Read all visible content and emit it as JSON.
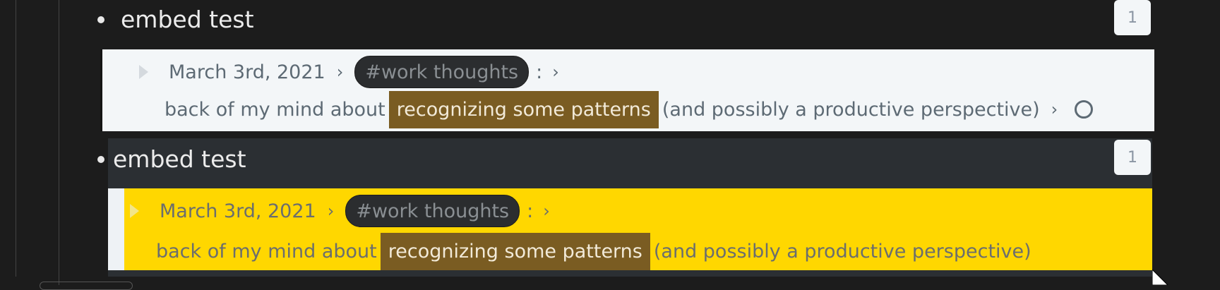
{
  "blocks": [
    {
      "title": "embed test",
      "ref_count": "1",
      "embed": {
        "date": "March 3rd, 2021",
        "tag": "#work thoughts",
        "colon": ":",
        "text_before": "back of my mind about",
        "highlight": "recognizing some patterns",
        "text_after": "(and possibly a productive perspective)"
      }
    },
    {
      "title": "embed test",
      "ref_count": "1",
      "embed": {
        "date": "March 3rd, 2021",
        "tag": "#work thoughts",
        "colon": ":",
        "text_before": "back of my mind about",
        "highlight": "recognizing some patterns",
        "text_after": "(and possibly a productive perspective)"
      }
    }
  ],
  "colors": {
    "background": "#1c1c1c",
    "embed_light": "#f3f6f8",
    "embed_yellow": "#ffd700",
    "block_selected": "#2b2f33",
    "highlight": "#7a5c22"
  },
  "icons": [
    "caret-right-icon",
    "chevron-right-icon",
    "circle-icon",
    "cursor-arrow-icon"
  ]
}
